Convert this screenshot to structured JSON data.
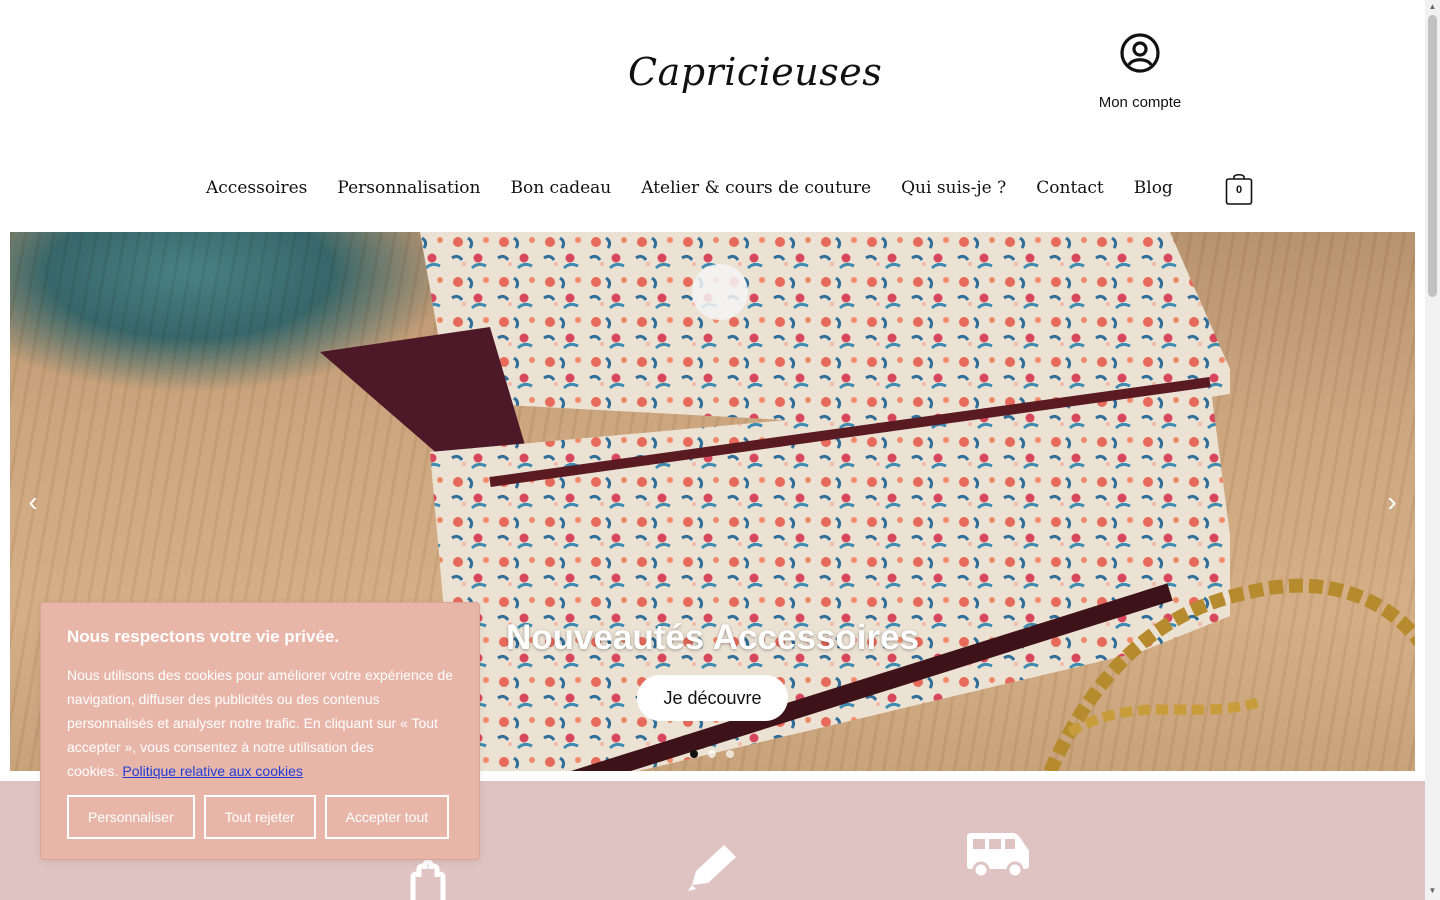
{
  "header": {
    "logo": "Capricieuses",
    "account_label": "Mon compte",
    "cart_count": "0"
  },
  "nav": {
    "items": [
      {
        "label": "Accessoires"
      },
      {
        "label": "Personnalisation"
      },
      {
        "label": "Bon cadeau"
      },
      {
        "label": "Atelier & cours de couture"
      },
      {
        "label": "Qui suis-je ?"
      },
      {
        "label": "Contact"
      },
      {
        "label": "Blog"
      }
    ]
  },
  "hero": {
    "title": "Nouveautés Accessoires",
    "button_label": "Je découvre",
    "prev_icon": "chevron-left-icon",
    "next_icon": "chevron-right-icon",
    "slides_count": 3,
    "active_slide": 1
  },
  "features": {
    "icons": [
      "hand-icon",
      "pencil-icon",
      "delivery-van-icon"
    ],
    "background": "#dfc3c3"
  },
  "cookie": {
    "title": "Nous respectons votre vie privée.",
    "text": "Nous utilisons des cookies pour améliorer votre expérience de navigation, diffuser des publicités ou des contenus personnalisés et analyser notre trafic. En cliquant sur « Tout accepter », vous consentez à notre utilisation des cookies.",
    "link": "Politique relative aux cookies",
    "buttons": {
      "customize": "Personnaliser",
      "reject": "Tout rejeter",
      "accept": "Accepter tout"
    },
    "background": "#e8b6a9"
  }
}
